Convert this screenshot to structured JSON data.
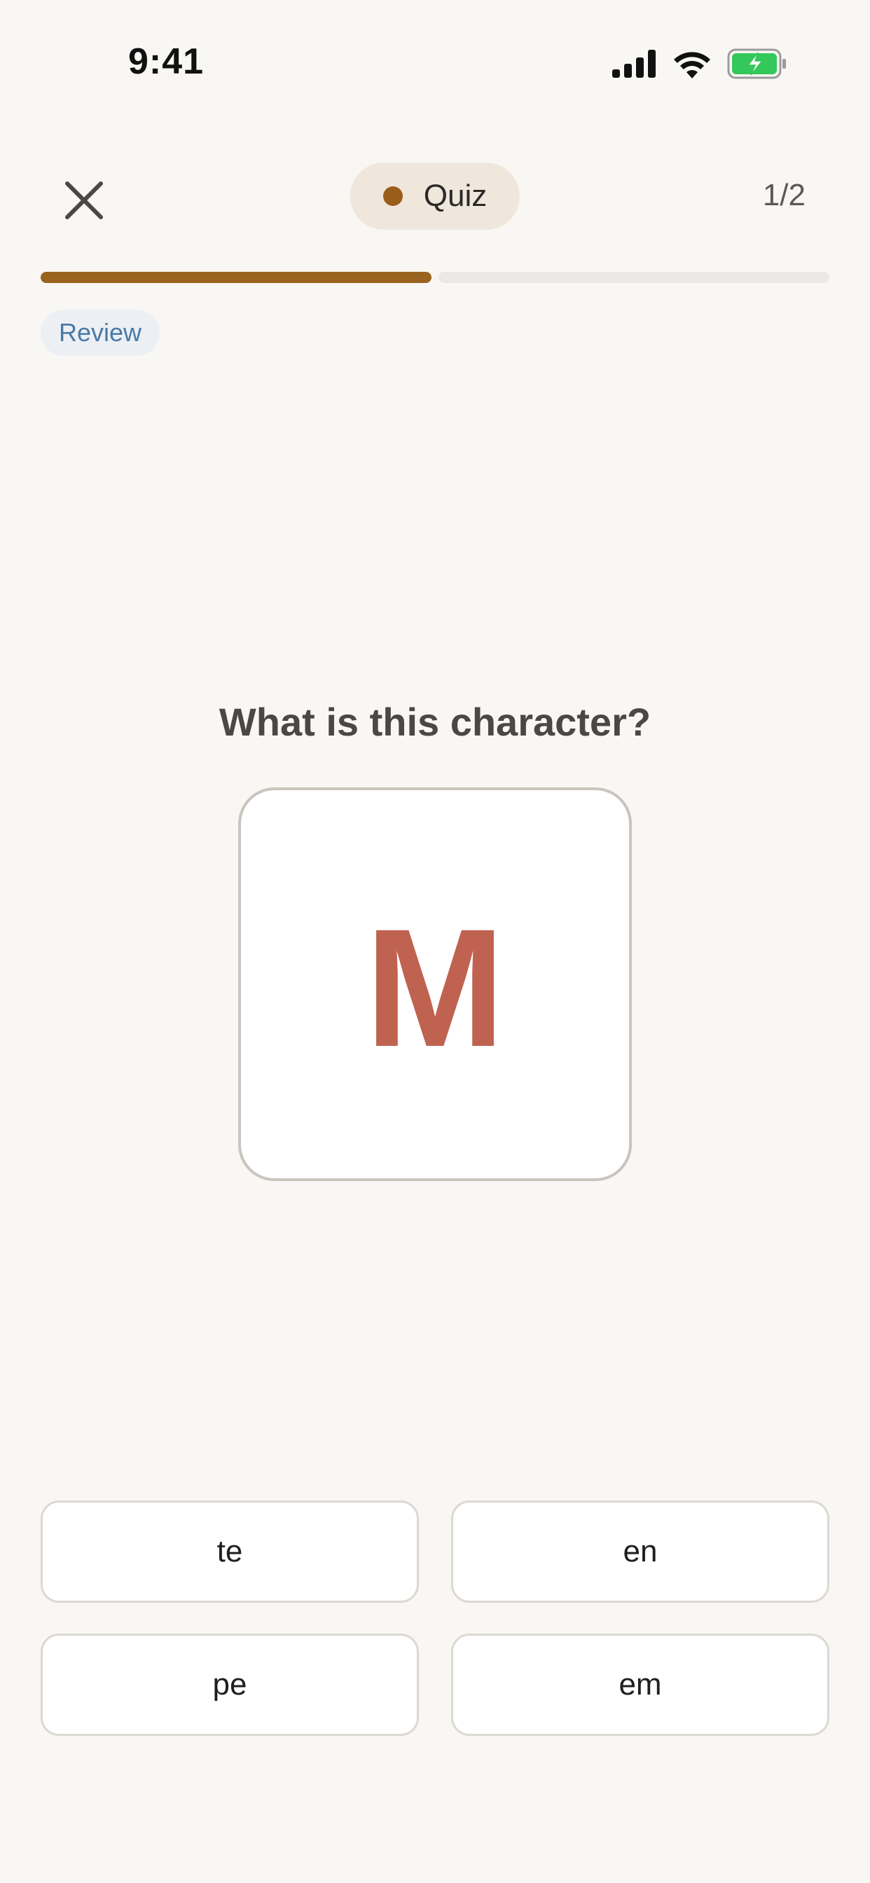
{
  "status_bar": {
    "time": "9:41",
    "icons": [
      "cellular-signal-icon",
      "wifi-icon",
      "battery-charging-icon"
    ],
    "battery_color": "#34c759"
  },
  "header": {
    "close_icon": "close-icon",
    "mode_label": "Quiz",
    "mode_dot_color": "#9a5e1b",
    "progress_text": "1/2"
  },
  "progress": {
    "current": 1,
    "total": 2,
    "fill_color": "#9a6420"
  },
  "review_badge": "Review",
  "question": {
    "prompt": "What is this character?",
    "character": "M",
    "character_color": "#c06250"
  },
  "answers": [
    {
      "label": "te"
    },
    {
      "label": "en"
    },
    {
      "label": "pe"
    },
    {
      "label": "em"
    }
  ]
}
